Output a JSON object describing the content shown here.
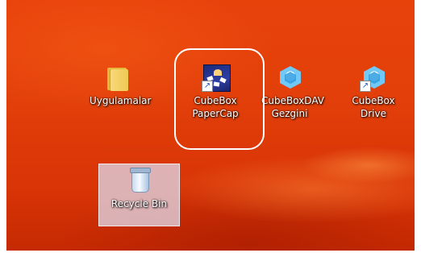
{
  "desktop": {
    "icons": [
      {
        "label": "Uygulamalar",
        "icon": "folder-icon"
      },
      {
        "label_line1": "CubeBox",
        "label_line2": "PaperCap",
        "icon": "papercap-icon"
      },
      {
        "label_line1": "CubeBoxDAV",
        "label_line2": "Gezgini",
        "icon": "cubebox-icon"
      },
      {
        "label_line1": "CubeBox",
        "label_line2": "Drive",
        "icon": "cubebox-icon"
      },
      {
        "label": "Recycle Bin",
        "icon": "recycle-bin-icon"
      }
    ],
    "highlight_color": "#ffffff",
    "wallpaper_color": "#e23f0a"
  }
}
